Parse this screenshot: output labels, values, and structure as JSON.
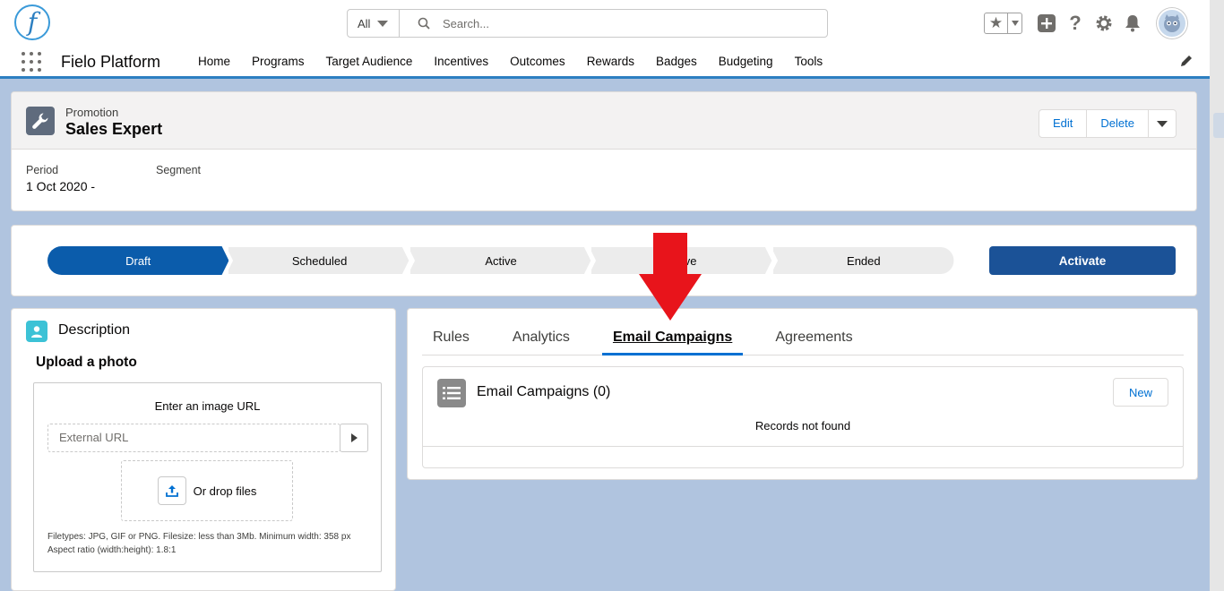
{
  "header": {
    "logo_letter": "f",
    "search": {
      "scope": "All",
      "placeholder": "Search..."
    },
    "icons": [
      "favorites-star-icon",
      "add-icon",
      "help-icon",
      "setup-gear-icon",
      "notifications-bell-icon",
      "user-avatar"
    ]
  },
  "nav": {
    "app_name": "Fielo Platform",
    "items": [
      "Home",
      "Programs",
      "Target Audience",
      "Incentives",
      "Outcomes",
      "Rewards",
      "Badges",
      "Budgeting",
      "Tools"
    ]
  },
  "record": {
    "object_type": "Promotion",
    "title": "Sales Expert",
    "actions": {
      "edit": "Edit",
      "delete": "Delete"
    },
    "fields": {
      "period_label": "Period",
      "period_value": "1 Oct 2020 -",
      "segment_label": "Segment",
      "segment_value": ""
    }
  },
  "path": {
    "stages": [
      {
        "label": "Draft",
        "current": true
      },
      {
        "label": "Scheduled",
        "current": false
      },
      {
        "label": "Active",
        "current": false
      },
      {
        "label": "tive",
        "current": false
      },
      {
        "label": "Ended",
        "current": false
      }
    ],
    "action_label": "Activate",
    "colors": {
      "current": "#0b5cab",
      "inactive": "#ececec",
      "action": "#1b5297"
    }
  },
  "description": {
    "title": "Description",
    "upload_title": "Upload a photo",
    "url_label": "Enter an image URL",
    "url_placeholder": "External URL",
    "drop_label": "Or drop files",
    "help_line1": "Filetypes: JPG, GIF or PNG. Filesize: less than 3Mb. Minimum width: 358 px",
    "help_line2": "Aspect ratio (width:height): 1.8:1"
  },
  "tabs": {
    "items": [
      {
        "label": "Rules",
        "active": false
      },
      {
        "label": "Analytics",
        "active": false
      },
      {
        "label": "Email Campaigns",
        "active": true
      },
      {
        "label": "Agreements",
        "active": false
      }
    ]
  },
  "related_list": {
    "title": "Email Campaigns (0)",
    "new_label": "New",
    "empty_text": "Records not found"
  },
  "annotation": {
    "arrow_color": "#e8141b"
  }
}
